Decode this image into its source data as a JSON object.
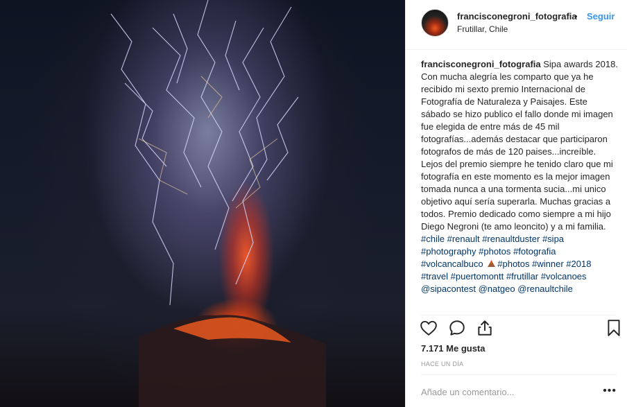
{
  "photo": {
    "alt_subject": ""
  },
  "header": {
    "username": "francisconegroni_fotografia",
    "separator": "•",
    "follow_label": "Seguir",
    "location": "Frutillar, Chile"
  },
  "caption": {
    "username": "francisconegroni_fotografia",
    "text": " Sipa awards 2018. Con mucha alegría les comparto que ya he recibido mi sexto premio Internacional de Fotografía de Naturaleza y Paisajes. Este sábado se hizo publico el fallo donde mi imagen fue elegida de entre más de 45 mil fotografías...además destacar que participaron fotografos de más de 120 paises...increíble. Lejos del premio siempre he tenido claro que mi fotografía en este momento es la mejor imagen tomada nunca a una tormenta sucia...mi unico objetivo aquí sería superarla. Muchas gracias a todos. Premio dedicado como siempre a mi hijo Diego Negroni (te amo leoncito) y a mi familia. ",
    "tags_line1": [
      "#chile",
      "#renault",
      "#renaultduster",
      "#sipa",
      "#photography",
      "#photos",
      "#fotografia",
      "#volcancalbuco"
    ],
    "tags_line2": [
      "#photos",
      "#winner",
      "#2018",
      "#travel",
      "#puertomontt",
      "#frutillar",
      "#volcanoes",
      "@sipacontest",
      "@natgeo",
      "@renaultchile"
    ]
  },
  "actions": {
    "like_icon": "heart-icon",
    "comment_icon": "speech-bubble-icon",
    "share_icon": "share-arrow-icon",
    "save_icon": "bookmark-icon"
  },
  "likes": "7.171 Me gusta",
  "time_ago": "HACE UN DÍA",
  "comment_box": {
    "placeholder": "Añade un comentario...",
    "more_label": "•••"
  },
  "colors": {
    "link_blue": "#3897f0",
    "hashtag": "#003569",
    "text": "#262626",
    "muted": "#999999",
    "border": "#efefef"
  }
}
